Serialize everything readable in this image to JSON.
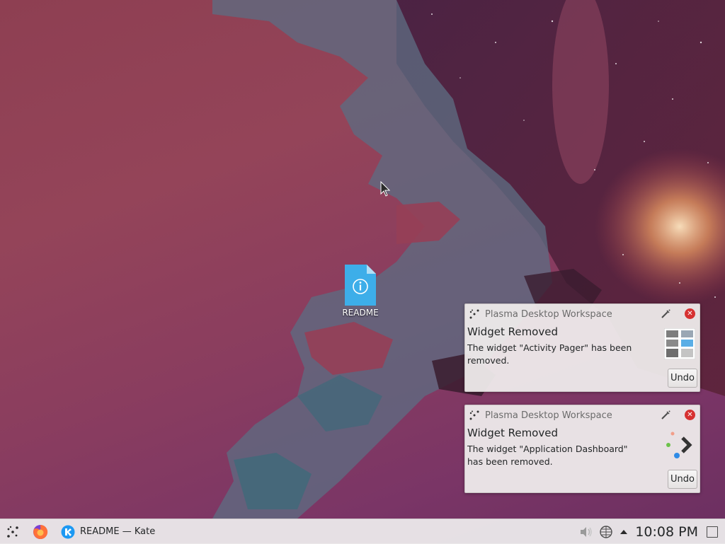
{
  "desktop": {
    "icons": [
      {
        "label": "README",
        "icon": "text-info-file-icon"
      }
    ]
  },
  "notifications": [
    {
      "app_name": "Plasma Desktop Workspace",
      "title": "Widget Removed",
      "body": "The widget \"Activity Pager\" has been removed.",
      "thumbnail": "pager-widget-icon",
      "action_label": "Undo"
    },
    {
      "app_name": "Plasma Desktop Workspace",
      "title": "Widget Removed",
      "body": "The widget \"Application Dashboard\" has been removed.",
      "thumbnail": "app-dashboard-widget-icon",
      "action_label": "Undo"
    }
  ],
  "panel": {
    "launcher_icon": "plasma-launcher-icon",
    "pinned": [
      {
        "name": "Firefox",
        "icon": "firefox-icon"
      }
    ],
    "tasks": [
      {
        "title": "README  — Kate",
        "icon": "kate-icon"
      }
    ],
    "tray": {
      "icons": [
        "volume-icon",
        "network-icon",
        "expand-arrow-icon"
      ],
      "clock": "10:08 PM"
    }
  },
  "colors": {
    "accent": "#3daee9",
    "close_red": "#d63131",
    "panel_bg": "#eae7e9",
    "notification_bg": "#efecec"
  }
}
